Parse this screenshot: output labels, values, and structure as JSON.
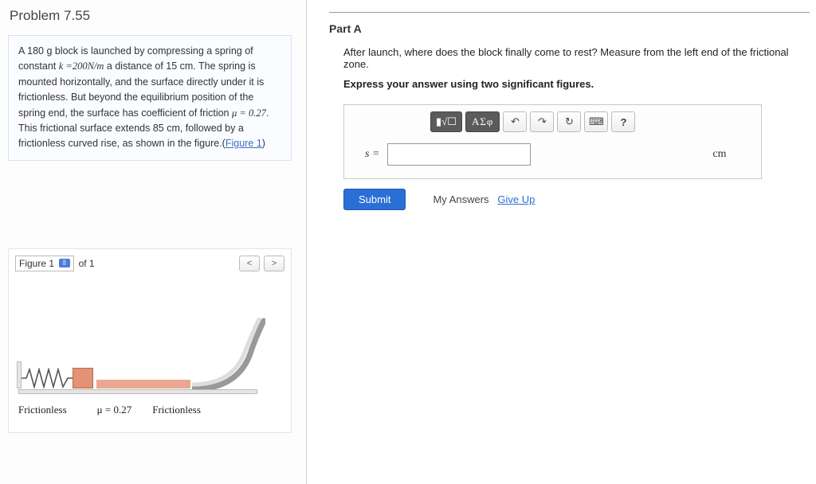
{
  "problem": {
    "title": "Problem 7.55",
    "statement_pre": "A 180 g block is launched by compressing a spring of constant ",
    "k_expr": "k =200N/m",
    "statement_mid1": " a distance of 15 cm. The spring is mounted horizontally, and the surface directly under it is frictionless. But beyond the equilibrium position of the spring end, the surface has coefficient of friction ",
    "mu_expr": "μ = 0.27",
    "statement_mid2": ". This frictional surface extends 85 cm, followed by a frictionless curved rise, as shown in the figure.(",
    "figure_link": "Figure 1",
    "statement_end": ")"
  },
  "figure": {
    "label": "Figure 1",
    "of_count": "of 1",
    "nav_prev": "<",
    "nav_next": ">",
    "caption_left": "Frictionless",
    "caption_mid": "μ = 0.27",
    "caption_right": "Frictionless"
  },
  "partA": {
    "heading": "Part A",
    "question": "After launch, where does the block finally come to rest? Measure from the left end of the frictional zone.",
    "instruction": "Express your answer using two significant figures.",
    "toolbar": {
      "templates": "▮√☐",
      "greek": "ΑΣφ",
      "undo": "↶",
      "redo": "↷",
      "reset": "↻",
      "keyboard": "⌨",
      "help": "?"
    },
    "var_label": "s =",
    "unit": "cm",
    "submit": "Submit",
    "my_answers": "My Answers",
    "give_up": "Give Up"
  }
}
